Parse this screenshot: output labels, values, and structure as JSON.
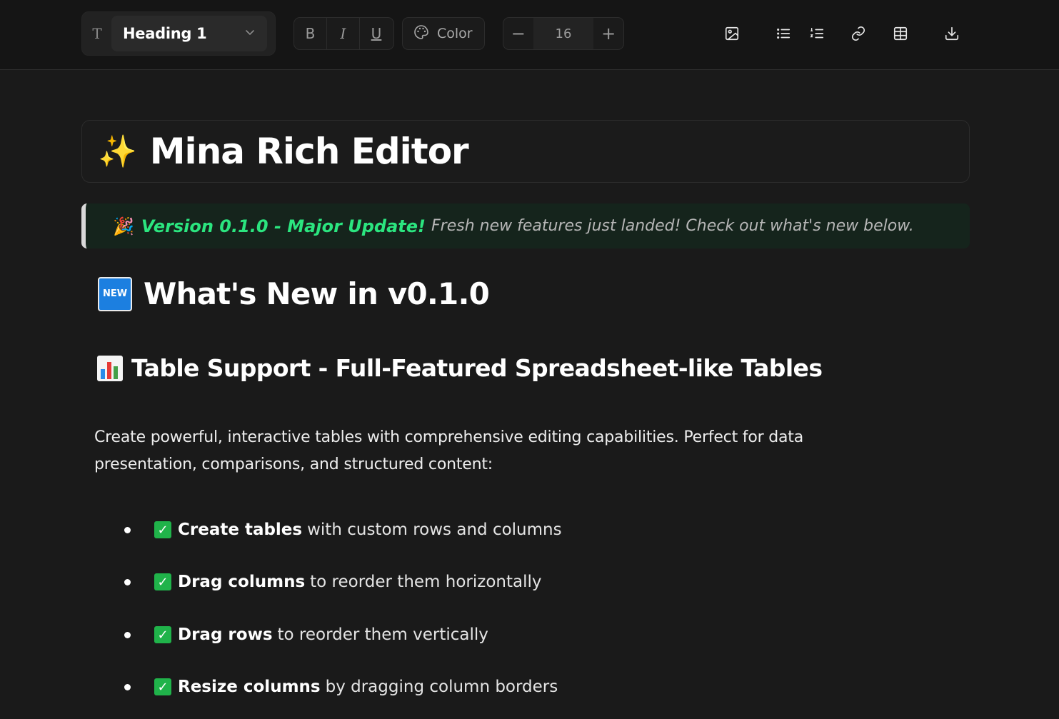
{
  "toolbar": {
    "block_type_icon": "T",
    "block_type_label": "Heading 1",
    "bold_label": "B",
    "italic_label": "I",
    "underline_label": "U",
    "color_label": "Color",
    "font_size": "16",
    "decrease_label": "−",
    "increase_label": "+",
    "icons": [
      "image-icon",
      "bullet-list-icon",
      "numbered-list-icon",
      "link-icon",
      "table-icon",
      "download-icon"
    ]
  },
  "document": {
    "title_emoji": "✨",
    "title": "Mina Rich Editor",
    "callout": {
      "emoji": "🎉",
      "highlight": "Version 0.1.0 - Major Update!",
      "text": "Fresh new features just landed! Check out what's new below."
    },
    "h2_badge": "NEW",
    "h2": "What's New in v0.1.0",
    "h3": "Table Support - Full-Featured Spreadsheet-like Tables",
    "paragraph": "Create powerful, interactive tables with comprehensive editing capabilities. Perfect for data presentation, comparisons, and structured content:",
    "list": [
      {
        "bold": "Create tables",
        "text": "with custom rows and columns"
      },
      {
        "bold": "Drag columns",
        "text": "to reorder them horizontally"
      },
      {
        "bold": "Drag rows",
        "text": "to reorder them vertically"
      },
      {
        "bold": "Resize columns",
        "text": "by dragging column borders"
      }
    ]
  },
  "colors": {
    "background": "#1a1a1a",
    "accent_green": "#2be57f",
    "check_green": "#20b34a",
    "badge_blue": "#1c7fe0"
  }
}
